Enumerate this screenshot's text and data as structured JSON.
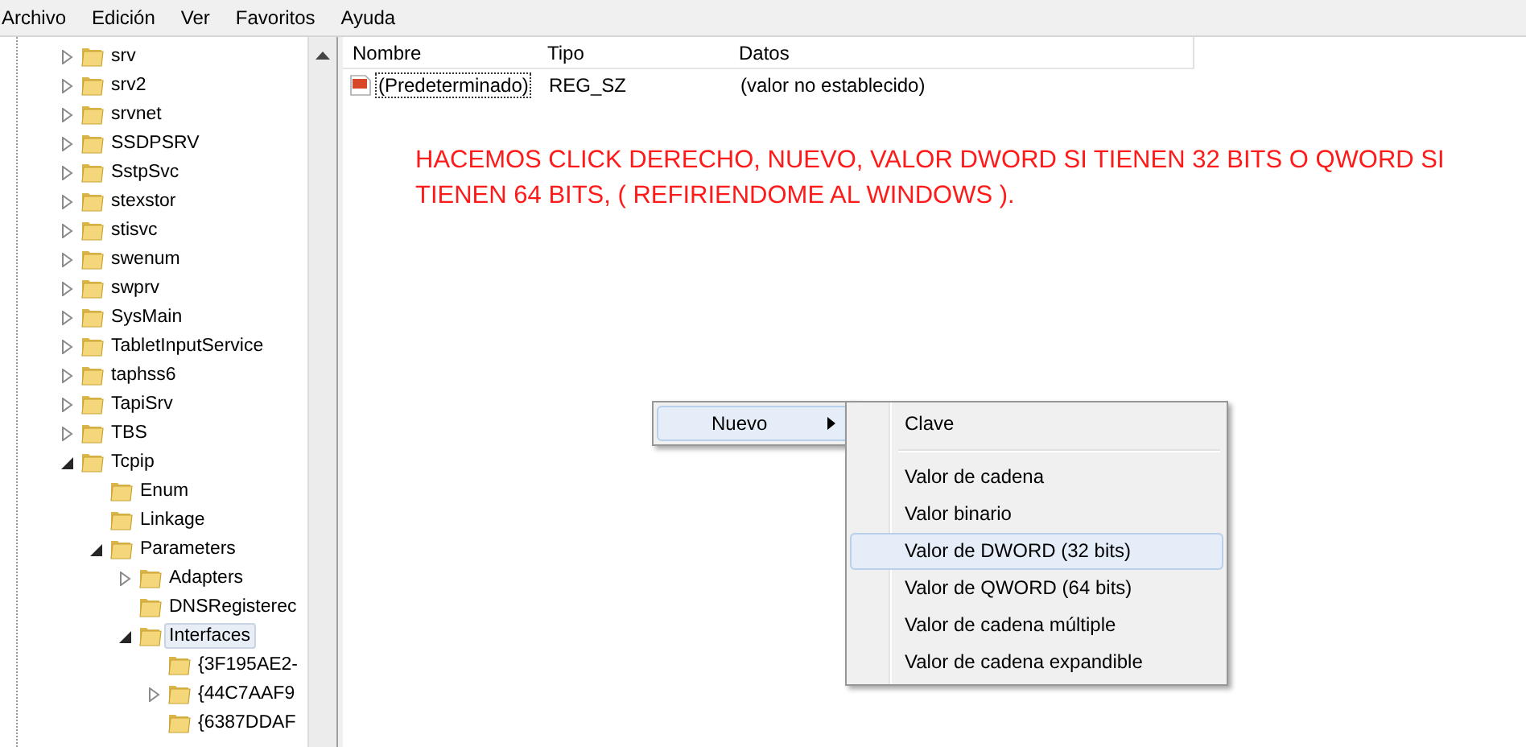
{
  "menu_bar": [
    "Archivo",
    "Edición",
    "Ver",
    "Favoritos",
    "Ayuda"
  ],
  "tree": [
    {
      "label": "srv",
      "expanded": false,
      "selected": false
    },
    {
      "label": "srv2",
      "expanded": false,
      "selected": false
    },
    {
      "label": "srvnet",
      "expanded": false,
      "selected": false
    },
    {
      "label": "SSDPSRV",
      "expanded": false,
      "selected": false
    },
    {
      "label": "SstpSvc",
      "expanded": false,
      "selected": false
    },
    {
      "label": "stexstor",
      "expanded": false,
      "selected": false
    },
    {
      "label": "stisvc",
      "expanded": false,
      "selected": false
    },
    {
      "label": "swenum",
      "expanded": false,
      "selected": false
    },
    {
      "label": "swprv",
      "expanded": false,
      "selected": false
    },
    {
      "label": "SysMain",
      "expanded": false,
      "selected": false
    },
    {
      "label": "TabletInputService",
      "expanded": false,
      "selected": false
    },
    {
      "label": "taphss6",
      "expanded": false,
      "selected": false
    },
    {
      "label": "TapiSrv",
      "expanded": false,
      "selected": false
    },
    {
      "label": "TBS",
      "expanded": false,
      "selected": false
    },
    {
      "label": "Tcpip",
      "expanded": true,
      "selected": false,
      "children": [
        {
          "label": "Enum",
          "selected": false
        },
        {
          "label": "Linkage",
          "selected": false
        },
        {
          "label": "Parameters",
          "expanded": true,
          "selected": false,
          "children": [
            {
              "label": "Adapters",
              "expanded": false,
              "selected": false
            },
            {
              "label": "DNSRegisterec",
              "selected": false
            },
            {
              "label": "Interfaces",
              "expanded": true,
              "selected": true,
              "children": [
                {
                  "label": "{3F195AE2-",
                  "selected": false
                },
                {
                  "label": "{44C7AAF9",
                  "expanded": false,
                  "selected": false
                },
                {
                  "label": "{6387DDAF",
                  "selected": false
                }
              ]
            }
          ]
        }
      ]
    }
  ],
  "values_table": {
    "columns": [
      "Nombre",
      "Tipo",
      "Datos"
    ],
    "rows": [
      {
        "name": "(Predeterminado)",
        "type": "REG_SZ",
        "data": "(valor no establecido)"
      }
    ]
  },
  "annotation": "HACEMOS CLICK DERECHO, NUEVO, VALOR DWORD SI TIENEN 32 BITS O QWORD SI TIENEN 64 BITS, ( REFIRIENDOME AL WINDOWS ).",
  "context_menu": {
    "label": "Nuevo",
    "submenu": [
      {
        "kind": "item",
        "label": "Clave",
        "selected": false
      },
      {
        "kind": "separator"
      },
      {
        "kind": "item",
        "label": "Valor de cadena",
        "selected": false
      },
      {
        "kind": "item",
        "label": "Valor binario",
        "selected": false
      },
      {
        "kind": "item",
        "label": "Valor de DWORD (32 bits)",
        "selected": true
      },
      {
        "kind": "item",
        "label": "Valor de QWORD (64 bits)",
        "selected": false
      },
      {
        "kind": "item",
        "label": "Valor de cadena múltiple",
        "selected": false
      },
      {
        "kind": "item",
        "label": "Valor de cadena expandible",
        "selected": false
      }
    ]
  }
}
